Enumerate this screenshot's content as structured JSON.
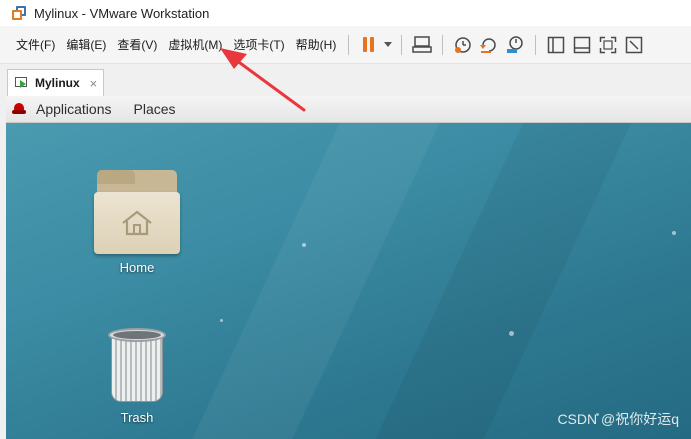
{
  "window": {
    "title": "Mylinux - VMware Workstation"
  },
  "menubar": {
    "items": [
      "文件(F)",
      "编辑(E)",
      "查看(V)",
      "虚拟机(M)",
      "选项卡(T)",
      "帮助(H)"
    ]
  },
  "toolbar": {
    "icons": [
      "pause-icon",
      "send-keys-icon",
      "snapshot-icon",
      "revert-snapshot-icon",
      "snapshot-manager-icon",
      "sidebar-icon",
      "console-view-icon",
      "fullscreen-icon",
      "unity-icon"
    ],
    "accent_color": "#e8731c"
  },
  "tabs": [
    {
      "label": "Mylinux",
      "close": "×"
    }
  ],
  "guest": {
    "topbar": {
      "applications": "Applications",
      "places": "Places"
    },
    "desktop_icons": [
      {
        "label": "Home",
        "icon": "home-folder-icon"
      },
      {
        "label": "Trash",
        "icon": "trash-icon"
      }
    ],
    "background_color": "#2f7d94"
  },
  "watermark": "CSDN @祝你好运q",
  "annotation": {
    "arrow_color": "#e8383d"
  }
}
